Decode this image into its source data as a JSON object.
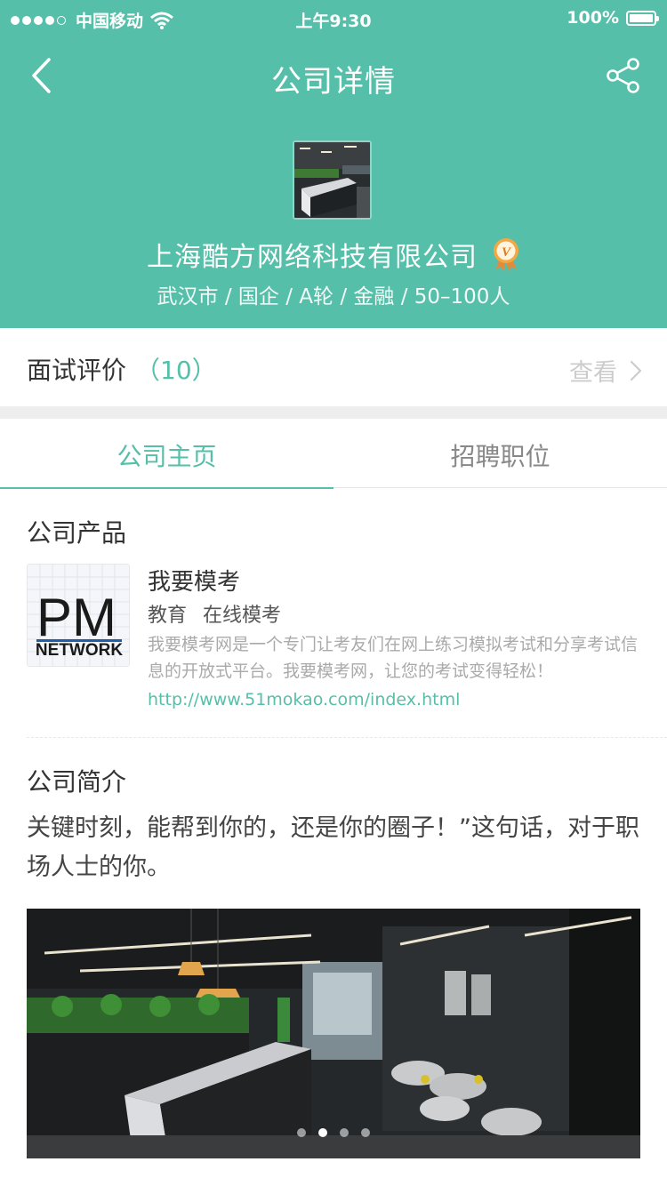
{
  "status_bar": {
    "carrier": "中国移动",
    "time": "上午9:30",
    "battery": "100%"
  },
  "nav": {
    "title": "公司详情"
  },
  "company": {
    "name": "上海酷方网络科技有限公司",
    "meta": "武汉市 / 国企 / A轮 / 金融 / 50–100人",
    "verified_badge_letter": "V"
  },
  "review": {
    "label": "面试评价",
    "count": "（10）",
    "action": "查看"
  },
  "tabs": [
    {
      "label": "公司主页",
      "active": true
    },
    {
      "label": "招聘职位",
      "active": false
    }
  ],
  "products_section": {
    "title": "公司产品",
    "items": [
      {
        "logo_text_top": "PM",
        "logo_text_bottom": "NETWORK",
        "name": "我要模考",
        "tags": [
          "教育",
          "在线模考"
        ],
        "description": "我要模考网是一个专门让考友们在网上练习模拟考试和分享考试信息的开放式平台。我要模考网，让您的考试变得轻松！",
        "url": "http://www.51mokao.com/index.html"
      }
    ]
  },
  "intro_section": {
    "title": "公司简介",
    "text": "关键时刻，能帮到你的，还是你的圈子！”这句话，对于职场人士的你。"
  },
  "banner": {
    "slide_count": 4,
    "active_index": 1
  },
  "colors": {
    "accent": "#56bfa9",
    "muted": "#aaaaaa"
  }
}
